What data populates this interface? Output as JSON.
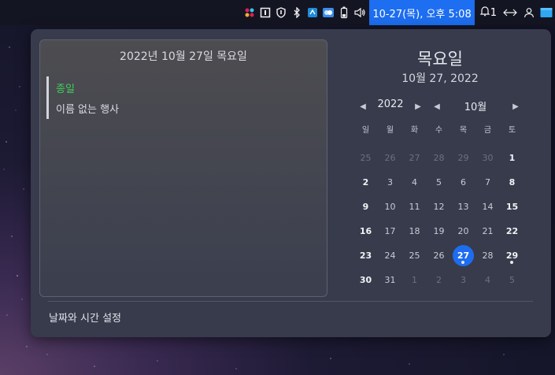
{
  "tray": {
    "clock": "10-27(목), 오후 5:08",
    "notification_count": "1",
    "icons": [
      "slack-icon",
      "todo-icon",
      "shield-icon",
      "bluetooth-icon",
      "app-icon",
      "weather-icon",
      "battery-icon",
      "volume-icon",
      "bell-icon",
      "network-icon",
      "user-icon",
      "window-icon"
    ]
  },
  "events": {
    "title": "2022년 10월 27일 목요일",
    "items": [
      {
        "tag": "종일",
        "name": "이름 없는 행사"
      }
    ]
  },
  "calendar": {
    "weekday": "목요일",
    "date": "10월 27, 2022",
    "year": "2022",
    "month": "10월",
    "weekdays": [
      "일",
      "월",
      "화",
      "수",
      "목",
      "금",
      "토"
    ],
    "weeks": [
      [
        {
          "d": "25",
          "o": true
        },
        {
          "d": "26",
          "o": true
        },
        {
          "d": "27",
          "o": true
        },
        {
          "d": "28",
          "o": true
        },
        {
          "d": "29",
          "o": true
        },
        {
          "d": "30",
          "o": true
        },
        {
          "d": "1"
        }
      ],
      [
        {
          "d": "2"
        },
        {
          "d": "3"
        },
        {
          "d": "4"
        },
        {
          "d": "5"
        },
        {
          "d": "6"
        },
        {
          "d": "7"
        },
        {
          "d": "8"
        }
      ],
      [
        {
          "d": "9"
        },
        {
          "d": "10"
        },
        {
          "d": "11"
        },
        {
          "d": "12"
        },
        {
          "d": "13"
        },
        {
          "d": "14"
        },
        {
          "d": "15"
        }
      ],
      [
        {
          "d": "16"
        },
        {
          "d": "17"
        },
        {
          "d": "18"
        },
        {
          "d": "19"
        },
        {
          "d": "20"
        },
        {
          "d": "21"
        },
        {
          "d": "22"
        }
      ],
      [
        {
          "d": "23"
        },
        {
          "d": "24"
        },
        {
          "d": "25"
        },
        {
          "d": "26"
        },
        {
          "d": "27",
          "today": true,
          "event": true
        },
        {
          "d": "28"
        },
        {
          "d": "29",
          "event": true
        }
      ],
      [
        {
          "d": "30"
        },
        {
          "d": "31"
        },
        {
          "d": "1",
          "o": true
        },
        {
          "d": "2",
          "o": true
        },
        {
          "d": "3",
          "o": true
        },
        {
          "d": "4",
          "o": true
        },
        {
          "d": "5",
          "o": true
        }
      ]
    ]
  },
  "footer": {
    "settings_label": "날짜와 시간 설정"
  },
  "colors": {
    "accent": "#1e6cf0",
    "allday": "#3fcf5a"
  }
}
